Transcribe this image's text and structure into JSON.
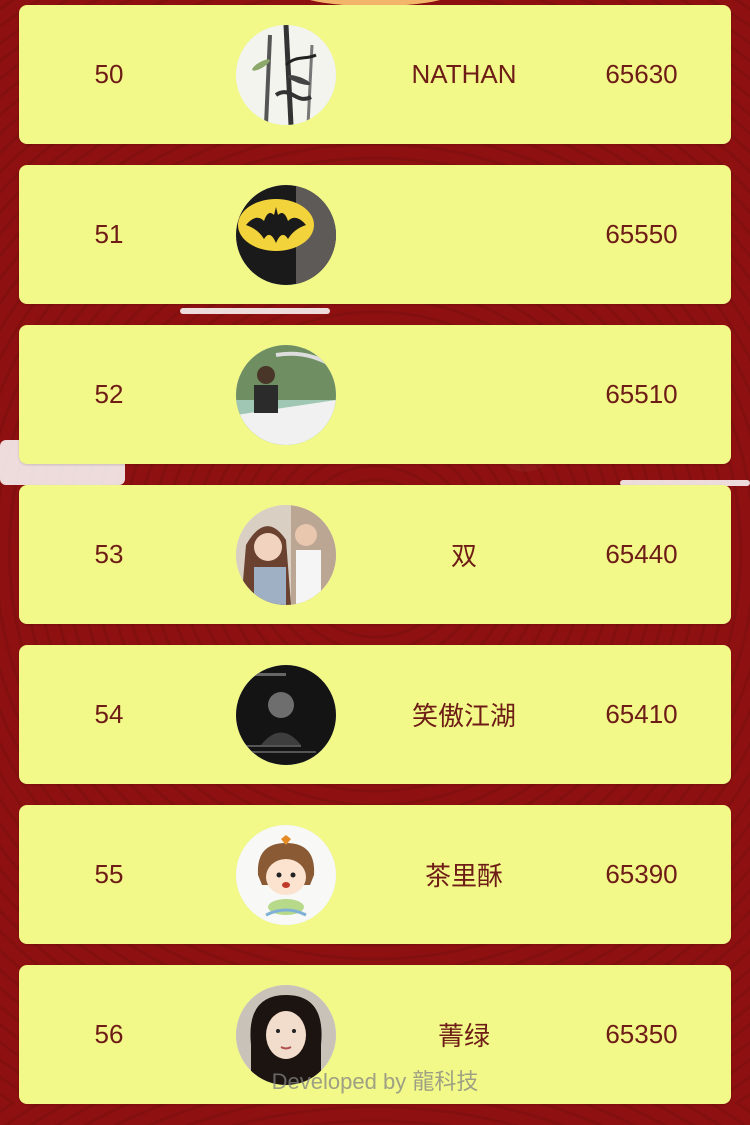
{
  "colors": {
    "background": "#8e1010",
    "row_fill": "#f2f989",
    "text": "#6d1c16"
  },
  "ranking": [
    {
      "rank": "50",
      "name": "NATHAN",
      "score": "65630",
      "avatar_icon": "bamboo-ink-painting-avatar"
    },
    {
      "rank": "51",
      "name": "",
      "score": "65550",
      "avatar_icon": "batman-logo-avatar"
    },
    {
      "rank": "52",
      "name": "",
      "score": "65510",
      "avatar_icon": "man-on-boat-avatar"
    },
    {
      "rank": "53",
      "name": "双",
      "score": "65440",
      "avatar_icon": "couple-photo-avatar"
    },
    {
      "rank": "54",
      "name": "笑傲江湖",
      "score": "65410",
      "avatar_icon": "dark-video-still-avatar"
    },
    {
      "rank": "55",
      "name": "茶里酥",
      "score": "65390",
      "avatar_icon": "cartoon-girl-avatar"
    },
    {
      "rank": "56",
      "name": "菁绿",
      "score": "65350",
      "avatar_icon": "woman-portrait-avatar"
    }
  ],
  "footer": {
    "credit": "Developed by 龍科技"
  }
}
